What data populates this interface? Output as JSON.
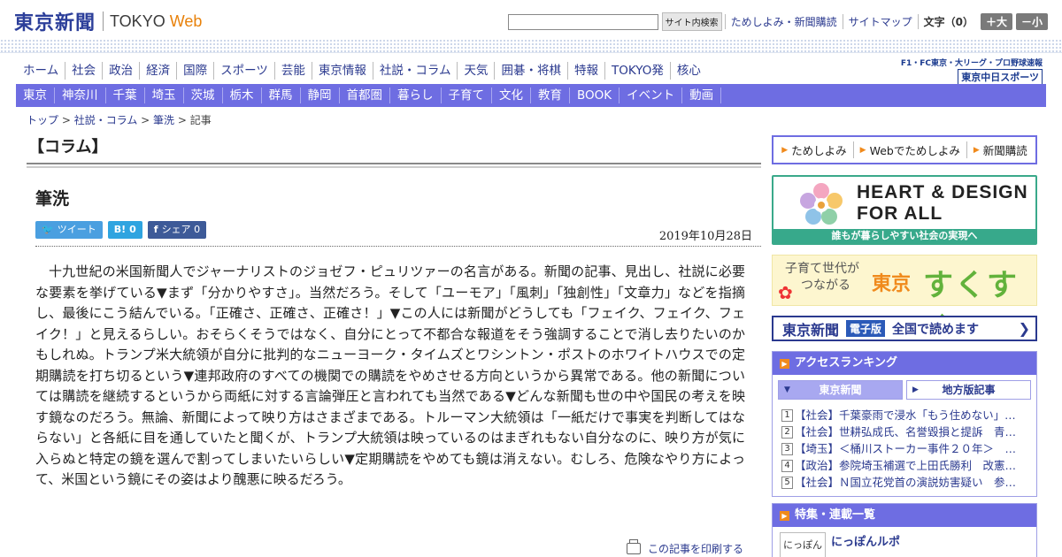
{
  "header": {
    "logo_jp": "東京新聞",
    "logo_en_a": "TOKYO",
    "logo_en_b": "Web",
    "search_button": "サイト内検索",
    "util_links": [
      "ためしよみ・新聞購読",
      "サイトマップ"
    ],
    "font_label": "文字（0）",
    "font_larger": "＋大",
    "font_smaller": "－小"
  },
  "nav": {
    "main": [
      "ホーム",
      "社会",
      "政治",
      "経済",
      "国際",
      "スポーツ",
      "芸能",
      "東京情報",
      "社説・コラム",
      "天気",
      "囲碁・将棋",
      "特報",
      "TOKYO発",
      "核心"
    ],
    "region": [
      "東京",
      "神奈川",
      "千葉",
      "埼玉",
      "茨城",
      "栃木",
      "群馬",
      "静岡",
      "首都圏",
      "暮らし",
      "子育て",
      "文化",
      "教育",
      "BOOK",
      "イベント",
      "動画"
    ],
    "chunichi_small": "F1・FC東京・大リーグ・プロ野球速報",
    "chunichi_big": "東京中日スポーツ"
  },
  "breadcrumb": {
    "top": "トップ",
    "sep": " > ",
    "section": "社説・コラム",
    "sub": "筆洗",
    "current": "記事"
  },
  "article": {
    "category": "【コラム】",
    "title": "筆洗",
    "date": "2019年10月28日",
    "share": {
      "tweet": "ツイート",
      "hatena_icon": "B!",
      "hatena_count": "0",
      "fb_icon": "f",
      "fb_label": "シェア",
      "fb_count": "0"
    },
    "body": "十九世紀の米国新聞人でジャーナリストのジョゼフ・ピュリツァーの名言がある。新聞の記事、見出し、社説に必要な要素を挙げている▼まず「分かりやすさ」。当然だろう。そして「ユーモア」「風刺」「独創性」「文章力」などを指摘し、最後にこう結んでいる。「正確さ、正確さ、正確さ！」▼この人には新聞がどうしても「フェイク、フェイク、フェイク！」と見えるらしい。おそらくそうではなく、自分にとって不都合な報道をそう強調することで消し去りたいのかもしれぬ。トランプ米大統領が自分に批判的なニューヨーク・タイムズとワシントン・ポストのホワイトハウスでの定期購読を打ち切るという▼連邦政府のすべての機関での購読をやめさせる方向というから異常である。他の新聞については購読を継続するというから両紙に対する言論弾圧と言われても当然である▼どんな新聞も世の中や国民の考えを映す鏡なのだろう。無論、新聞によって映り方はさまざまである。トルーマン大統領は「一紙だけで事実を判断してはならない」と各紙に目を通していたと聞くが、トランプ大統領は映っているのはまぎれもない自分なのに、映り方が気に入らぬと特定の鏡を選んで割ってしまいたいらしい▼定期購読をやめても鏡は消えない。むしろ、危険なやり方によって、米国という鏡にその姿はより醜悪に映るだろう。",
    "print_label": "この記事を印刷する"
  },
  "sidebar": {
    "links": [
      "ためしよみ",
      "Webでためしよみ",
      "新聞購読"
    ],
    "hd_title_1": "HEART & DESIGN",
    "hd_title_2": "FOR ALL",
    "hd_foot": "誰もが暮らしやすい社会の実現へ",
    "sukusuku_sub_1": "子育て世代が",
    "sukusuku_sub_2": "つながる",
    "sukusuku_city": "東京",
    "sukusuku_main": "すくすく",
    "denshiban_name": "東京新聞",
    "denshiban_tag": "電子版",
    "denshiban_text": "全国で読めます",
    "ranking_title": "アクセスランキング",
    "ranking_tabs": [
      "東京新聞",
      "地方版記事"
    ],
    "ranking": [
      {
        "num": "1",
        "text": "【社会】千葉豪雨で浸水「もう住めない」…"
      },
      {
        "num": "2",
        "text": "【社会】世耕弘成氏、名誉毀損と提訴　青…"
      },
      {
        "num": "3",
        "text": "【埼玉】＜桶川ストーカー事件２０年＞　…"
      },
      {
        "num": "4",
        "text": "【政治】参院埼玉補選で上田氏勝利　改憲…"
      },
      {
        "num": "5",
        "text": "【社会】Ｎ国立花党首の演説妨害疑い　参…"
      }
    ],
    "features_title": "特集・連載一覧",
    "feature_thumb": "にっぽん",
    "feature_title": "にっぽんルポ"
  }
}
